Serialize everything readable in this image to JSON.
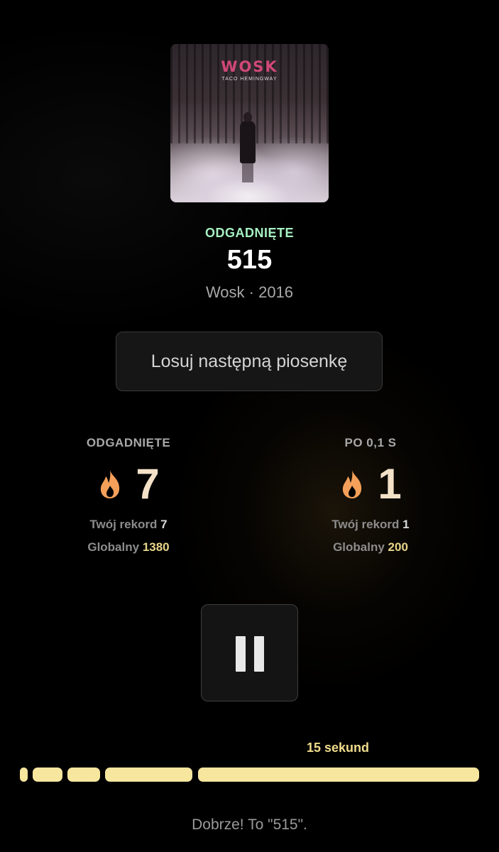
{
  "album": {
    "cover_title": "WOSK",
    "cover_subtitle": "TACO HEMINGWAY"
  },
  "result": {
    "status": "ODGADNIĘTE",
    "title": "515",
    "meta": "Wosk · 2016"
  },
  "next_button_label": "Losuj następną piosenkę",
  "stats": [
    {
      "label": "ODGADNIĘTE",
      "streak": "7",
      "record_label": "Twój rekord",
      "record_value": "7",
      "global_label": "Globalny",
      "global_value": "1380",
      "icon": "flame-icon"
    },
    {
      "label": "PO 0,1 S",
      "streak": "1",
      "record_label": "Twój rekord",
      "record_value": "1",
      "global_label": "Globalny",
      "global_value": "200",
      "icon": "flame-icon"
    }
  ],
  "player": {
    "button_icon": "pause-icon",
    "seconds_label": "15 sekund",
    "segments_total": 5,
    "segments_unlocked": 5
  },
  "feedback": "Dobrze! To \"515\".",
  "colors": {
    "status_green": "#a6f0c2",
    "streak_number": "#f4e2c8",
    "flame_orange": "#f4a05a",
    "global_gold": "#e8d68a",
    "progress_yellow": "#f7e69e"
  }
}
